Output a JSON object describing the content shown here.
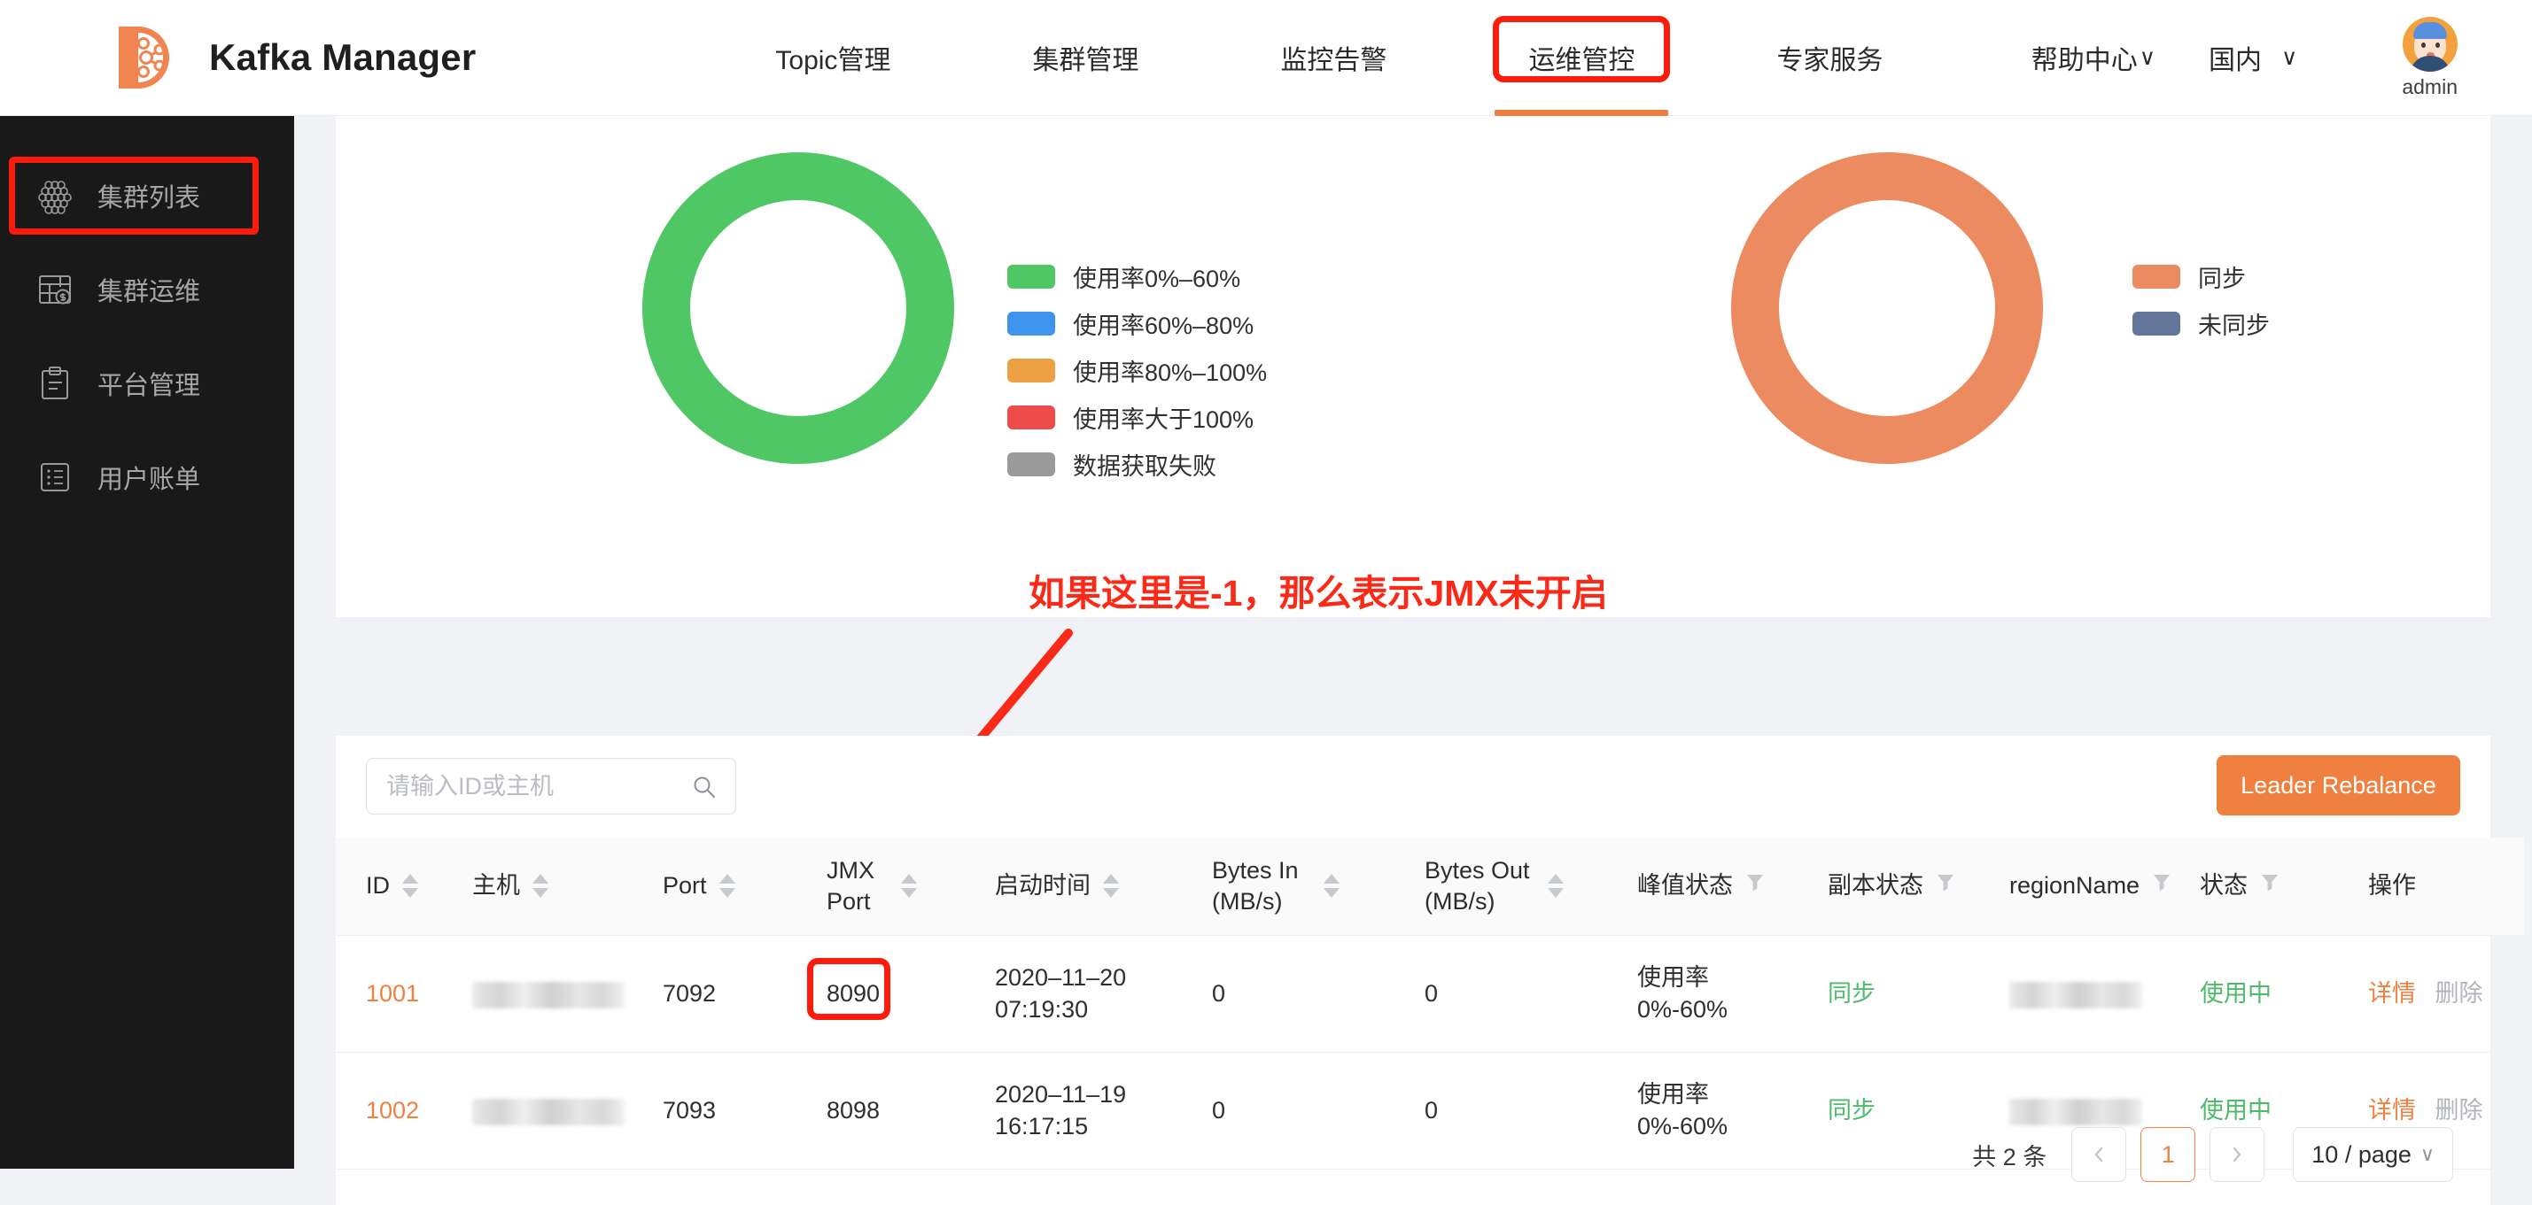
{
  "header": {
    "brand_title": "Kafka Manager",
    "logo_icon": "kafka-d-logo",
    "nav": [
      {
        "label": "Topic管理",
        "active": false
      },
      {
        "label": "集群管理",
        "active": false
      },
      {
        "label": "监控告警",
        "active": false
      },
      {
        "label": "运维管控",
        "active": true,
        "annotated": true
      },
      {
        "label": "专家服务",
        "active": false
      }
    ],
    "help_center": "帮助中心",
    "help_chevron": "∨",
    "region": "国内",
    "region_chevron": "∨",
    "username": "admin"
  },
  "sidebar": {
    "items": [
      {
        "label": "集群列表",
        "icon": "cluster-grid-icon",
        "active": true,
        "annotated": true
      },
      {
        "label": "集群运维",
        "icon": "table-dollar-icon",
        "active": false,
        "annotated": false
      },
      {
        "label": "平台管理",
        "icon": "clipboard-icon",
        "active": false,
        "annotated": false
      },
      {
        "label": "用户账单",
        "icon": "list-icon",
        "active": false,
        "annotated": false
      }
    ]
  },
  "annotations": {
    "jmx_note": "如果这里是-1，那么表示JMX未开启",
    "annotation_color": "#fb2a18"
  },
  "charts": {
    "usage_legend": [
      {
        "color": "#4fc765",
        "label": "使用率0%–60%"
      },
      {
        "color": "#3e95ef",
        "label": "使用率60%–80%"
      },
      {
        "color": "#eda143",
        "label": "使用率80%–100%"
      },
      {
        "color": "#ee4b4b",
        "label": "使用率大于100%"
      },
      {
        "color": "#9a9a9a",
        "label": "数据获取失败"
      }
    ],
    "sync_legend": [
      {
        "color": "#ec8b60",
        "label": "同步"
      },
      {
        "color": "#63769a",
        "label": "未同步"
      }
    ]
  },
  "chart_data": [
    {
      "type": "pie",
      "title": "",
      "legend_position": "right",
      "labels": [
        "使用率0%–60%",
        "使用率60%–80%",
        "使用率80%–100%",
        "使用率大于100%",
        "数据获取失败"
      ],
      "values": [
        2,
        0,
        0,
        0,
        0
      ],
      "colors": [
        "#4fc765",
        "#3e95ef",
        "#eda143",
        "#ee4b4b",
        "#9a9a9a"
      ],
      "donut": true,
      "inner_radius_ratio": 0.69
    },
    {
      "type": "pie",
      "title": "",
      "legend_position": "right",
      "labels": [
        "同步",
        "未同步"
      ],
      "values": [
        2,
        0
      ],
      "colors": [
        "#ec8b60",
        "#63769a"
      ],
      "donut": true,
      "inner_radius_ratio": 0.69
    }
  ],
  "toolbar": {
    "search_placeholder": "请输入ID或主机",
    "search_value": "",
    "search_icon": "search-icon",
    "rebalance_label": "Leader Rebalance"
  },
  "table": {
    "columns": [
      {
        "key": "id",
        "label": "ID",
        "sortable": true,
        "filterable": false
      },
      {
        "key": "host",
        "label": "主机",
        "sortable": true,
        "filterable": false
      },
      {
        "key": "port",
        "label": "Port",
        "sortable": true,
        "filterable": false
      },
      {
        "key": "jmx_port",
        "label": "JMX Port",
        "sortable": true,
        "filterable": false
      },
      {
        "key": "start_time",
        "label": "启动时间",
        "sortable": true,
        "filterable": false
      },
      {
        "key": "bytes_in",
        "label": "Bytes In (MB/s)",
        "sortable": true,
        "filterable": false
      },
      {
        "key": "bytes_out",
        "label": "Bytes Out (MB/s)",
        "sortable": true,
        "filterable": false
      },
      {
        "key": "peak",
        "label": "峰值状态",
        "sortable": false,
        "filterable": true
      },
      {
        "key": "replica",
        "label": "副本状态",
        "sortable": false,
        "filterable": true
      },
      {
        "key": "region",
        "label": "regionName",
        "sortable": false,
        "filterable": true
      },
      {
        "key": "status",
        "label": "状态",
        "sortable": false,
        "filterable": true
      },
      {
        "key": "action",
        "label": "操作",
        "sortable": false,
        "filterable": false
      }
    ],
    "rows": [
      {
        "id": "1001",
        "host": "",
        "host_redacted": true,
        "port": "7092",
        "jmx_port": "8090",
        "jmx_annotated": true,
        "start_date": "2020–11–20",
        "start_clock": "07:19:30",
        "bytes_in": "0",
        "bytes_out": "0",
        "peak_line1": "使用率",
        "peak_line2": "0%-60%",
        "replica": "同步",
        "region": "",
        "region_redacted": true,
        "status": "使用中",
        "detail_label": "详情",
        "delete_label": "删除"
      },
      {
        "id": "1002",
        "host": "",
        "host_redacted": true,
        "port": "7093",
        "jmx_port": "8098",
        "jmx_annotated": false,
        "start_date": "2020–11–19",
        "start_clock": "16:17:15",
        "bytes_in": "0",
        "bytes_out": "0",
        "peak_line1": "使用率",
        "peak_line2": "0%-60%",
        "replica": "同步",
        "region": "",
        "region_redacted": true,
        "status": "使用中",
        "detail_label": "详情",
        "delete_label": "删除"
      }
    ]
  },
  "pagination": {
    "total_text": "共 2 条",
    "prev_icon": "chevron-left-icon",
    "next_icon": "chevron-right-icon",
    "current_page": "1",
    "page_size": "10 / page",
    "page_size_chevron": "∨"
  },
  "theme": {
    "accent": "#ef8040",
    "annotation_red": "#fb1c0c",
    "success_green": "#4dbb6a",
    "sidebar_bg": "#191919"
  }
}
